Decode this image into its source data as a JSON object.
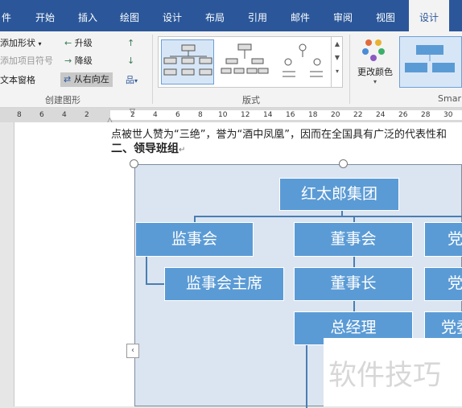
{
  "tabs": [
    "件",
    "开始",
    "插入",
    "绘图",
    "设计",
    "布局",
    "引用",
    "邮件",
    "审阅",
    "视图",
    "设计"
  ],
  "ribbon": {
    "create_group": {
      "add_shape": "添加形状",
      "add_bullet": "添加项目符号",
      "text_pane": "文本窗格",
      "promote": "升级",
      "demote": "降级",
      "rtl": "从右向左",
      "label": "创建图形"
    },
    "layout_group": {
      "label": "版式"
    },
    "colors_button": "更改颜色",
    "smartart_label": "Smar"
  },
  "ruler_numbers": [
    "8",
    "6",
    "4",
    "2",
    "2",
    "4",
    "6",
    "8",
    "10",
    "12",
    "14",
    "16",
    "18",
    "20",
    "22",
    "24",
    "26",
    "28",
    "30"
  ],
  "document": {
    "para_line": "点被世人赞为“三绝”，誉为“酒中凤凰”，因而在全国具有广泛的代表性和",
    "heading": "二、领导班组"
  },
  "orgchart": {
    "root": "红太郎集团",
    "n1": "监事会",
    "n2": "董事会",
    "n3": "党",
    "n4": "监事会主席",
    "n5": "董事长",
    "n6": "党",
    "n7": "总经理",
    "n8": "党委"
  },
  "watermark": "软件技巧",
  "colors": {
    "ribbon_blue": "#2b579a",
    "node_blue": "#5b9bd5",
    "canvas": "#dbe5f1"
  }
}
